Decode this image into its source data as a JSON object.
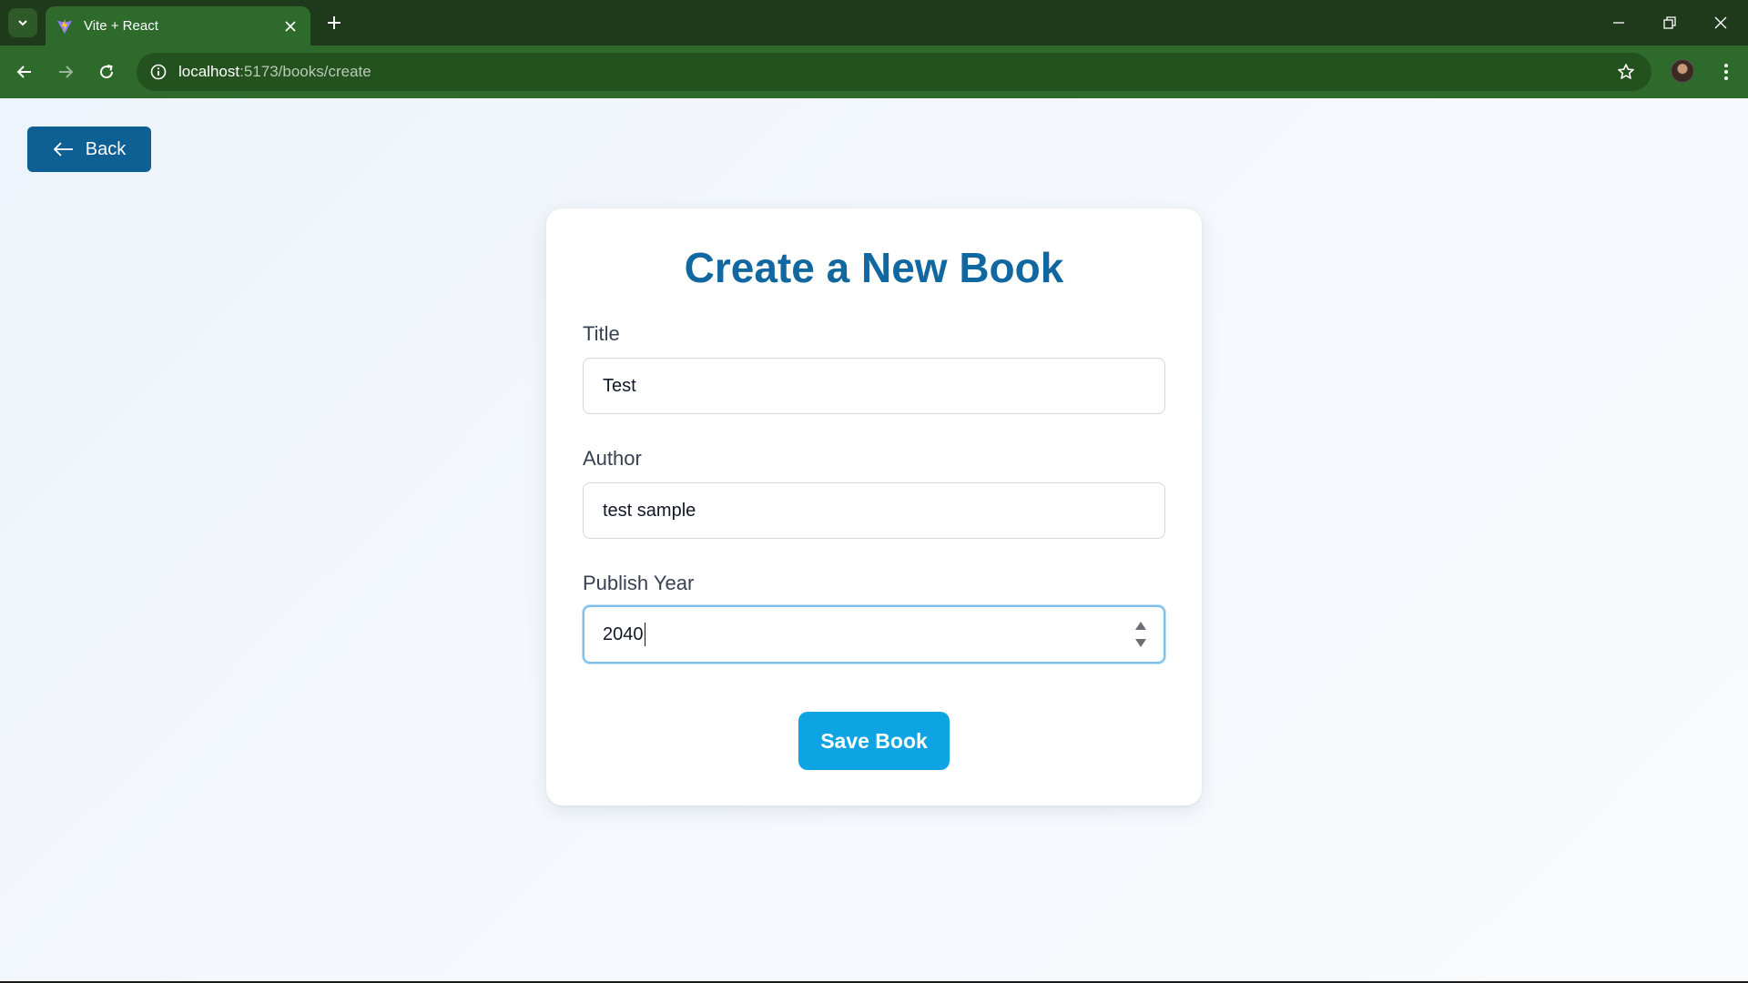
{
  "browser": {
    "tab_title": "Vite + React",
    "url_host": "localhost",
    "url_path": ":5173/books/create"
  },
  "page": {
    "back_label": "Back",
    "form_title": "Create a New Book",
    "fields": [
      {
        "label": "Title",
        "value": "Test"
      },
      {
        "label": "Author",
        "value": "test sample"
      },
      {
        "label": "Publish Year",
        "value": "2040"
      }
    ],
    "save_label": "Save Book"
  },
  "colors": {
    "chrome_dark": "#1e3a1b",
    "chrome_toolbar": "#2e6a2b",
    "back_button": "#0d5f94",
    "title_text": "#11679f",
    "save_button": "#0ea4e4",
    "focus_ring": "#7cc0ea"
  }
}
